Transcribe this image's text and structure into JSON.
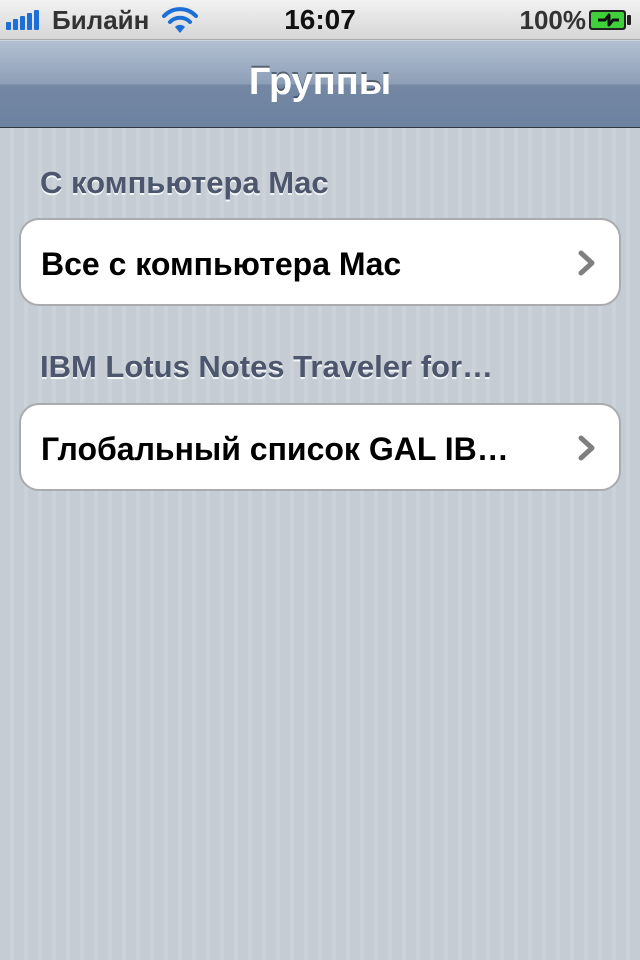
{
  "status_bar": {
    "carrier": "Билайн",
    "time": "16:07",
    "battery_percent": "100%",
    "signal_icon": "signal-bars-icon",
    "wifi_icon": "wifi-icon",
    "battery_icon": "battery-charging-icon"
  },
  "nav": {
    "title": "Группы"
  },
  "sections": [
    {
      "header": "С компьютера Mac",
      "items": [
        {
          "label": "Все с компьютера Mac",
          "icon": "chevron-right-icon"
        }
      ]
    },
    {
      "header": "IBM Lotus Notes Traveler for…",
      "items": [
        {
          "label": "Глобальный список GAL IB…",
          "icon": "chevron-right-icon"
        }
      ]
    }
  ],
  "colors": {
    "background": "#c5ccd4",
    "nav_bar": "#6d82a0",
    "section_header_text": "#4c566c",
    "signal_blue": "#1d6fd6",
    "battery_green": "#3fd13a"
  }
}
